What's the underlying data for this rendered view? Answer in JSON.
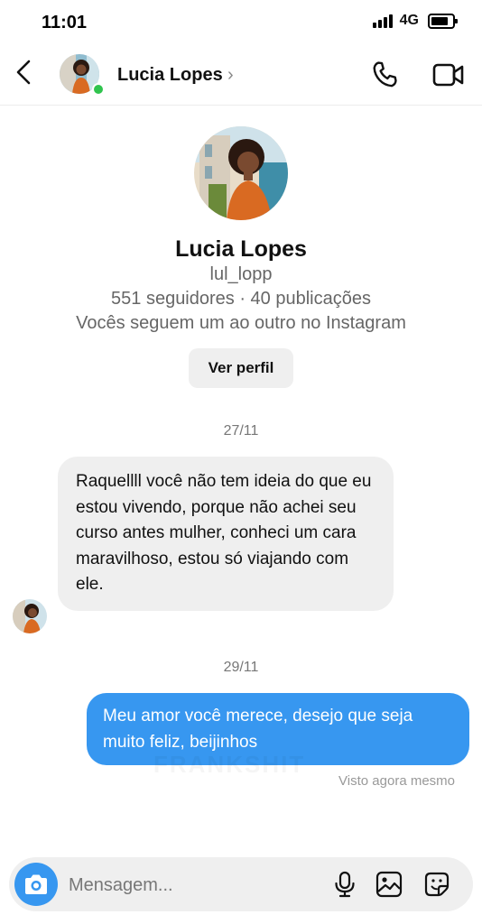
{
  "status_bar": {
    "time": "11:01",
    "network": "4G"
  },
  "header": {
    "name": "Lucia Lopes",
    "chevron": "›",
    "icons": [
      "back-arrow-icon",
      "phone-icon",
      "video-camera-icon"
    ]
  },
  "profile": {
    "name": "Lucia Lopes",
    "username": "lul_lopp",
    "stats": "551 seguidores · 40 publicações",
    "mutual": "Vocês seguem um ao outro no Instagram",
    "view_button": "Ver perfil"
  },
  "conversation": {
    "date1": "27/11",
    "incoming_text": "Raquellll você não tem ideia do que eu estou vivendo, porque não achei seu curso antes mulher, conheci um cara maravilhoso, estou só viajando com ele.",
    "date2": "29/11",
    "outgoing_text": "Meu amor você merece, desejo que seja muito feliz, beijinhos",
    "seen": "Visto agora mesmo",
    "watermark": "FRANKSHIT"
  },
  "composer": {
    "placeholder": "Mensagem...",
    "icons": [
      "camera-icon",
      "microphone-icon",
      "gallery-icon",
      "sticker-icon"
    ]
  },
  "colors": {
    "accent": "#3797f0",
    "bubble_in": "#efefef",
    "online": "#30c44e"
  }
}
